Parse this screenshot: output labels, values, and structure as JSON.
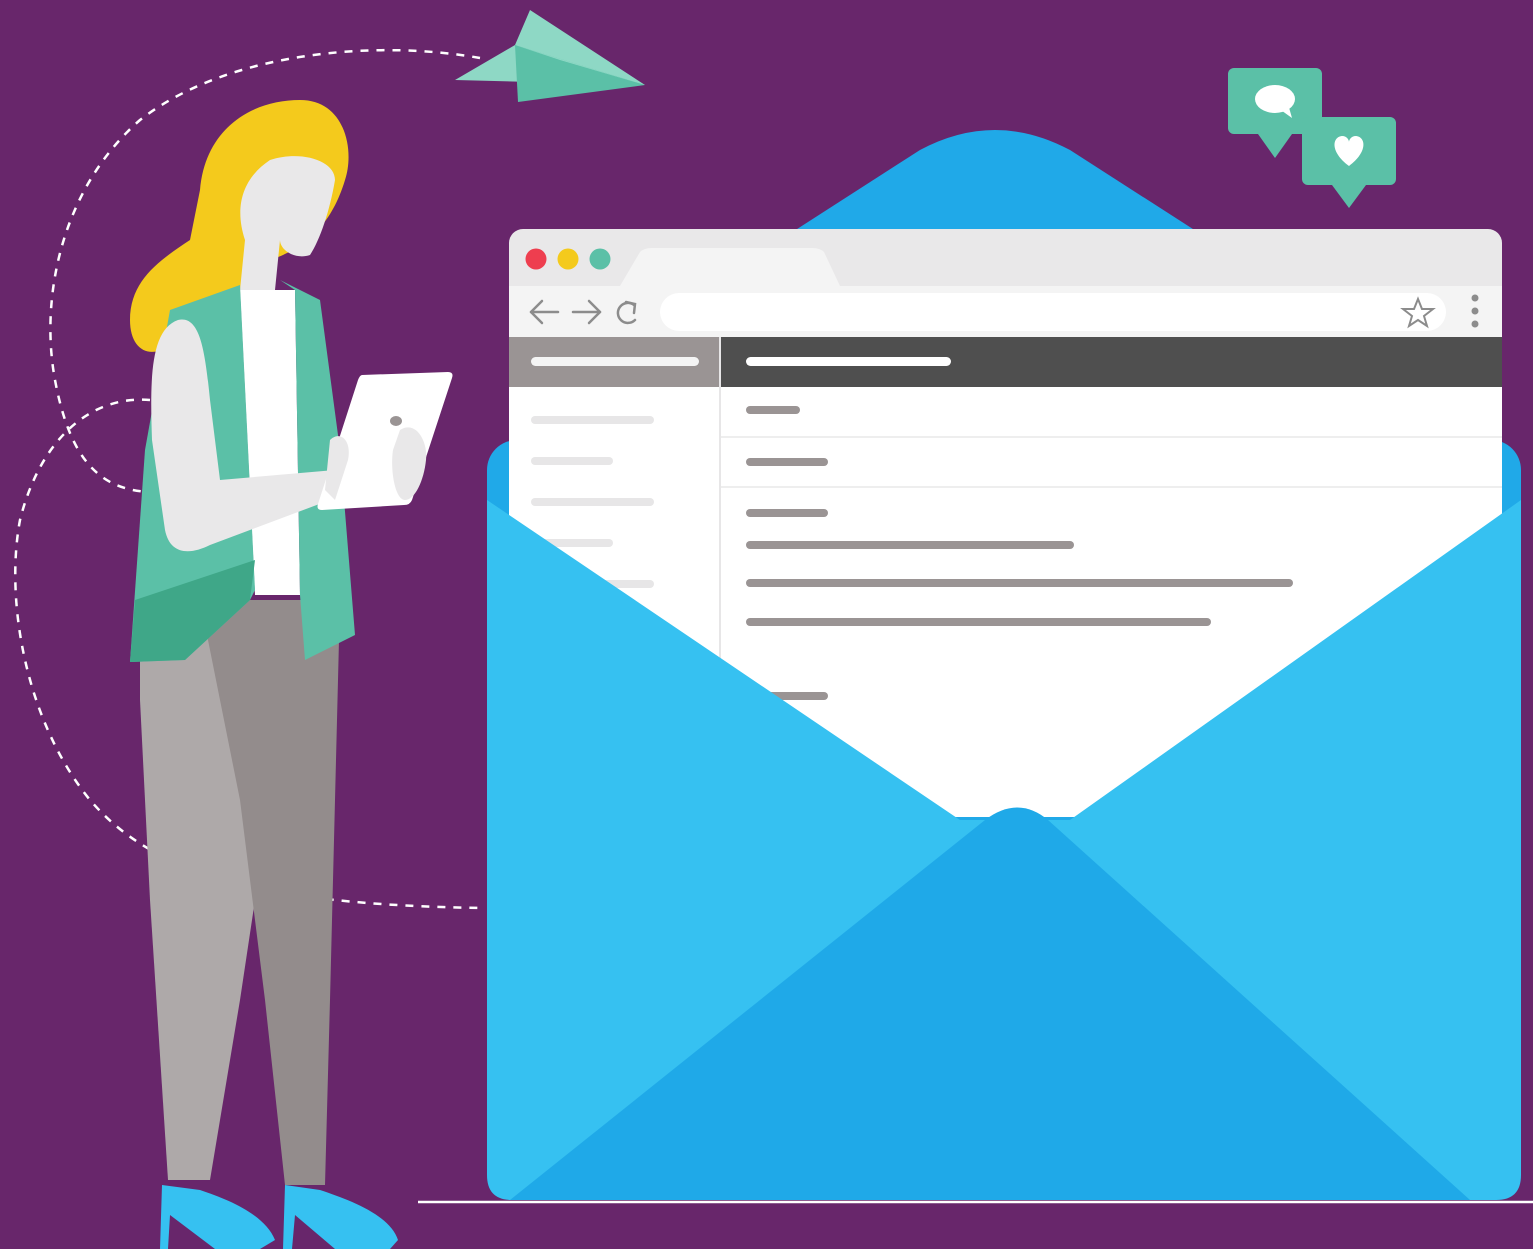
{
  "colors": {
    "background": "#68266B",
    "envelope_back": "#20A9E8",
    "envelope_front": "#36C1F1",
    "envelope_flap": "#1FA9E8",
    "browser_chrome": "#E9E8E9",
    "tab_active": "#F4F4F4",
    "sidebar_header": "#9A9494",
    "content_header": "#4F4F4F",
    "placeholder_line": "#9A9494",
    "sidebar_line": "#E7E6E7",
    "dot_red": "#EE3E4F",
    "dot_yellow": "#F4CA1C",
    "dot_green": "#5BC0A7",
    "bubble_green": "#5BC0A7",
    "plane_light": "#8ED8C5",
    "plane_dark": "#5BC0A7",
    "hair": "#F4CA1C",
    "skin": "#E9E8E9",
    "vest": "#5BC0A7",
    "vest_shade": "#3FA788",
    "pants_light": "#AEA9A9",
    "pants_dark": "#938C8C",
    "shoes": "#36C1F1"
  },
  "browser": {
    "window_controls": [
      "close",
      "minimize",
      "maximize"
    ],
    "icons": [
      "back-arrow-icon",
      "forward-arrow-icon",
      "reload-icon",
      "star-icon",
      "menu-kebab-icon"
    ],
    "address_bar_value": ""
  },
  "chat_bubbles": [
    "speech-bubble-icon",
    "heart-icon"
  ]
}
